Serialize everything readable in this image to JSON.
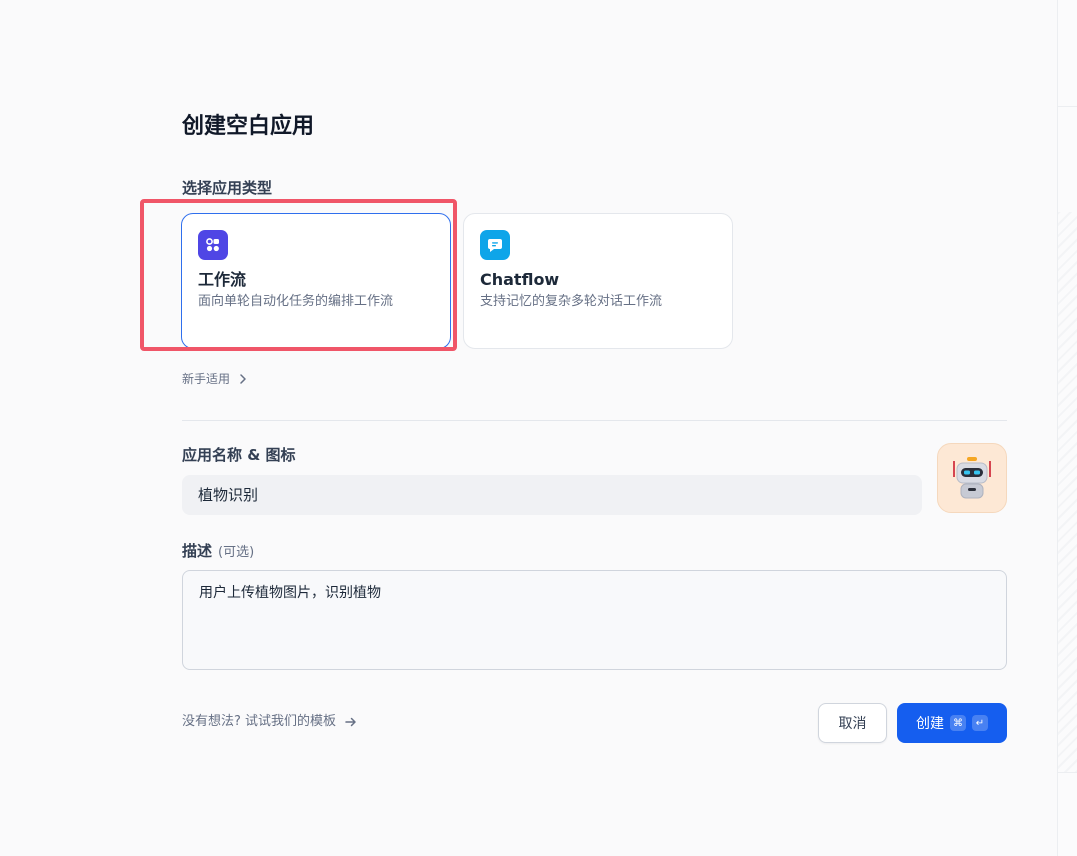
{
  "page": {
    "title": "创建空白应用"
  },
  "app_type": {
    "label": "选择应用类型",
    "options": [
      {
        "icon": "workflow-icon",
        "icon_color": "#4f46e5",
        "title": "工作流",
        "description": "面向单轮自动化任务的编排工作流",
        "selected": true
      },
      {
        "icon": "chat-bubble-icon",
        "icon_color": "#0ea5e9",
        "title": "Chatflow",
        "description": "支持记忆的复杂多轮对话工作流",
        "selected": false
      }
    ],
    "beginner_link": "新手适用"
  },
  "name_section": {
    "label": "应用名称 & 图标",
    "value": "植物识别",
    "avatar_icon": "robot-icon",
    "avatar_bg": "#fde8d5"
  },
  "description_section": {
    "label": "描述",
    "optional": "(可选)",
    "value": "用户上传植物图片，识别植物"
  },
  "footer": {
    "template_link": "没有想法? 试试我们的模板",
    "cancel_label": "取消",
    "create_label": "创建",
    "shortcut_keys": [
      "⌘",
      "↵"
    ]
  },
  "colors": {
    "primary": "#155eef",
    "highlight": "#f05668"
  }
}
